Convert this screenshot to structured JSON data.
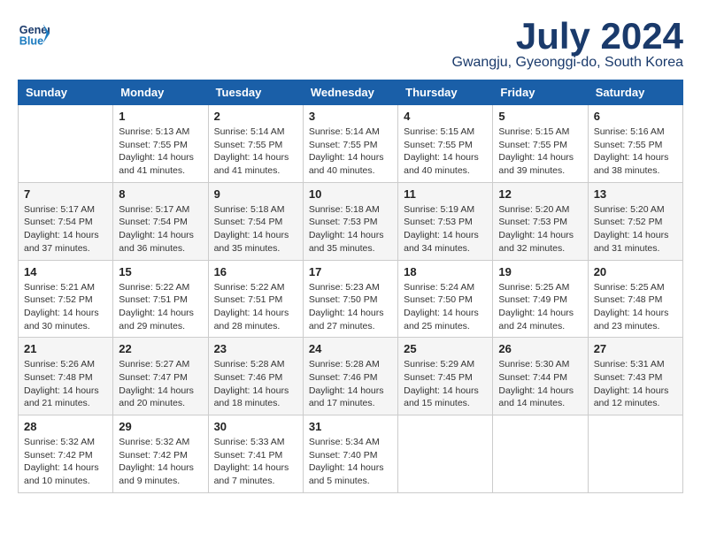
{
  "logo": {
    "line1": "General",
    "line2": "Blue"
  },
  "title": {
    "month": "July 2024",
    "location": "Gwangju, Gyeonggi-do, South Korea"
  },
  "headers": [
    "Sunday",
    "Monday",
    "Tuesday",
    "Wednesday",
    "Thursday",
    "Friday",
    "Saturday"
  ],
  "weeks": [
    [
      {
        "day": "",
        "info": ""
      },
      {
        "day": "1",
        "info": "Sunrise: 5:13 AM\nSunset: 7:55 PM\nDaylight: 14 hours\nand 41 minutes."
      },
      {
        "day": "2",
        "info": "Sunrise: 5:14 AM\nSunset: 7:55 PM\nDaylight: 14 hours\nand 41 minutes."
      },
      {
        "day": "3",
        "info": "Sunrise: 5:14 AM\nSunset: 7:55 PM\nDaylight: 14 hours\nand 40 minutes."
      },
      {
        "day": "4",
        "info": "Sunrise: 5:15 AM\nSunset: 7:55 PM\nDaylight: 14 hours\nand 40 minutes."
      },
      {
        "day": "5",
        "info": "Sunrise: 5:15 AM\nSunset: 7:55 PM\nDaylight: 14 hours\nand 39 minutes."
      },
      {
        "day": "6",
        "info": "Sunrise: 5:16 AM\nSunset: 7:55 PM\nDaylight: 14 hours\nand 38 minutes."
      }
    ],
    [
      {
        "day": "7",
        "info": "Sunrise: 5:17 AM\nSunset: 7:54 PM\nDaylight: 14 hours\nand 37 minutes."
      },
      {
        "day": "8",
        "info": "Sunrise: 5:17 AM\nSunset: 7:54 PM\nDaylight: 14 hours\nand 36 minutes."
      },
      {
        "day": "9",
        "info": "Sunrise: 5:18 AM\nSunset: 7:54 PM\nDaylight: 14 hours\nand 35 minutes."
      },
      {
        "day": "10",
        "info": "Sunrise: 5:18 AM\nSunset: 7:53 PM\nDaylight: 14 hours\nand 35 minutes."
      },
      {
        "day": "11",
        "info": "Sunrise: 5:19 AM\nSunset: 7:53 PM\nDaylight: 14 hours\nand 34 minutes."
      },
      {
        "day": "12",
        "info": "Sunrise: 5:20 AM\nSunset: 7:53 PM\nDaylight: 14 hours\nand 32 minutes."
      },
      {
        "day": "13",
        "info": "Sunrise: 5:20 AM\nSunset: 7:52 PM\nDaylight: 14 hours\nand 31 minutes."
      }
    ],
    [
      {
        "day": "14",
        "info": "Sunrise: 5:21 AM\nSunset: 7:52 PM\nDaylight: 14 hours\nand 30 minutes."
      },
      {
        "day": "15",
        "info": "Sunrise: 5:22 AM\nSunset: 7:51 PM\nDaylight: 14 hours\nand 29 minutes."
      },
      {
        "day": "16",
        "info": "Sunrise: 5:22 AM\nSunset: 7:51 PM\nDaylight: 14 hours\nand 28 minutes."
      },
      {
        "day": "17",
        "info": "Sunrise: 5:23 AM\nSunset: 7:50 PM\nDaylight: 14 hours\nand 27 minutes."
      },
      {
        "day": "18",
        "info": "Sunrise: 5:24 AM\nSunset: 7:50 PM\nDaylight: 14 hours\nand 25 minutes."
      },
      {
        "day": "19",
        "info": "Sunrise: 5:25 AM\nSunset: 7:49 PM\nDaylight: 14 hours\nand 24 minutes."
      },
      {
        "day": "20",
        "info": "Sunrise: 5:25 AM\nSunset: 7:48 PM\nDaylight: 14 hours\nand 23 minutes."
      }
    ],
    [
      {
        "day": "21",
        "info": "Sunrise: 5:26 AM\nSunset: 7:48 PM\nDaylight: 14 hours\nand 21 minutes."
      },
      {
        "day": "22",
        "info": "Sunrise: 5:27 AM\nSunset: 7:47 PM\nDaylight: 14 hours\nand 20 minutes."
      },
      {
        "day": "23",
        "info": "Sunrise: 5:28 AM\nSunset: 7:46 PM\nDaylight: 14 hours\nand 18 minutes."
      },
      {
        "day": "24",
        "info": "Sunrise: 5:28 AM\nSunset: 7:46 PM\nDaylight: 14 hours\nand 17 minutes."
      },
      {
        "day": "25",
        "info": "Sunrise: 5:29 AM\nSunset: 7:45 PM\nDaylight: 14 hours\nand 15 minutes."
      },
      {
        "day": "26",
        "info": "Sunrise: 5:30 AM\nSunset: 7:44 PM\nDaylight: 14 hours\nand 14 minutes."
      },
      {
        "day": "27",
        "info": "Sunrise: 5:31 AM\nSunset: 7:43 PM\nDaylight: 14 hours\nand 12 minutes."
      }
    ],
    [
      {
        "day": "28",
        "info": "Sunrise: 5:32 AM\nSunset: 7:42 PM\nDaylight: 14 hours\nand 10 minutes."
      },
      {
        "day": "29",
        "info": "Sunrise: 5:32 AM\nSunset: 7:42 PM\nDaylight: 14 hours\nand 9 minutes."
      },
      {
        "day": "30",
        "info": "Sunrise: 5:33 AM\nSunset: 7:41 PM\nDaylight: 14 hours\nand 7 minutes."
      },
      {
        "day": "31",
        "info": "Sunrise: 5:34 AM\nSunset: 7:40 PM\nDaylight: 14 hours\nand 5 minutes."
      },
      {
        "day": "",
        "info": ""
      },
      {
        "day": "",
        "info": ""
      },
      {
        "day": "",
        "info": ""
      }
    ]
  ]
}
